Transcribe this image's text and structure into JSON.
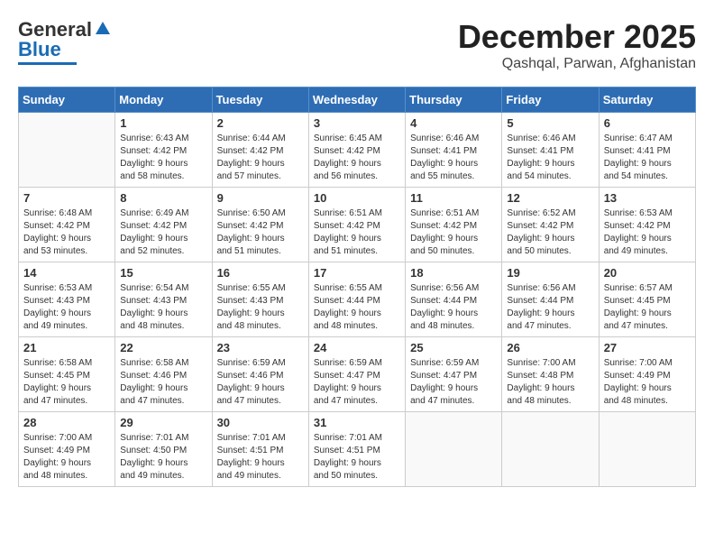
{
  "header": {
    "logo_general": "General",
    "logo_blue": "Blue",
    "month": "December 2025",
    "location": "Qashqal, Parwan, Afghanistan"
  },
  "days_of_week": [
    "Sunday",
    "Monday",
    "Tuesday",
    "Wednesday",
    "Thursday",
    "Friday",
    "Saturday"
  ],
  "weeks": [
    [
      {
        "day": "",
        "info": ""
      },
      {
        "day": "1",
        "info": "Sunrise: 6:43 AM\nSunset: 4:42 PM\nDaylight: 9 hours\nand 58 minutes."
      },
      {
        "day": "2",
        "info": "Sunrise: 6:44 AM\nSunset: 4:42 PM\nDaylight: 9 hours\nand 57 minutes."
      },
      {
        "day": "3",
        "info": "Sunrise: 6:45 AM\nSunset: 4:42 PM\nDaylight: 9 hours\nand 56 minutes."
      },
      {
        "day": "4",
        "info": "Sunrise: 6:46 AM\nSunset: 4:41 PM\nDaylight: 9 hours\nand 55 minutes."
      },
      {
        "day": "5",
        "info": "Sunrise: 6:46 AM\nSunset: 4:41 PM\nDaylight: 9 hours\nand 54 minutes."
      },
      {
        "day": "6",
        "info": "Sunrise: 6:47 AM\nSunset: 4:41 PM\nDaylight: 9 hours\nand 54 minutes."
      }
    ],
    [
      {
        "day": "7",
        "info": "Sunrise: 6:48 AM\nSunset: 4:42 PM\nDaylight: 9 hours\nand 53 minutes."
      },
      {
        "day": "8",
        "info": "Sunrise: 6:49 AM\nSunset: 4:42 PM\nDaylight: 9 hours\nand 52 minutes."
      },
      {
        "day": "9",
        "info": "Sunrise: 6:50 AM\nSunset: 4:42 PM\nDaylight: 9 hours\nand 51 minutes."
      },
      {
        "day": "10",
        "info": "Sunrise: 6:51 AM\nSunset: 4:42 PM\nDaylight: 9 hours\nand 51 minutes."
      },
      {
        "day": "11",
        "info": "Sunrise: 6:51 AM\nSunset: 4:42 PM\nDaylight: 9 hours\nand 50 minutes."
      },
      {
        "day": "12",
        "info": "Sunrise: 6:52 AM\nSunset: 4:42 PM\nDaylight: 9 hours\nand 50 minutes."
      },
      {
        "day": "13",
        "info": "Sunrise: 6:53 AM\nSunset: 4:42 PM\nDaylight: 9 hours\nand 49 minutes."
      }
    ],
    [
      {
        "day": "14",
        "info": "Sunrise: 6:53 AM\nSunset: 4:43 PM\nDaylight: 9 hours\nand 49 minutes."
      },
      {
        "day": "15",
        "info": "Sunrise: 6:54 AM\nSunset: 4:43 PM\nDaylight: 9 hours\nand 48 minutes."
      },
      {
        "day": "16",
        "info": "Sunrise: 6:55 AM\nSunset: 4:43 PM\nDaylight: 9 hours\nand 48 minutes."
      },
      {
        "day": "17",
        "info": "Sunrise: 6:55 AM\nSunset: 4:44 PM\nDaylight: 9 hours\nand 48 minutes."
      },
      {
        "day": "18",
        "info": "Sunrise: 6:56 AM\nSunset: 4:44 PM\nDaylight: 9 hours\nand 48 minutes."
      },
      {
        "day": "19",
        "info": "Sunrise: 6:56 AM\nSunset: 4:44 PM\nDaylight: 9 hours\nand 47 minutes."
      },
      {
        "day": "20",
        "info": "Sunrise: 6:57 AM\nSunset: 4:45 PM\nDaylight: 9 hours\nand 47 minutes."
      }
    ],
    [
      {
        "day": "21",
        "info": "Sunrise: 6:58 AM\nSunset: 4:45 PM\nDaylight: 9 hours\nand 47 minutes."
      },
      {
        "day": "22",
        "info": "Sunrise: 6:58 AM\nSunset: 4:46 PM\nDaylight: 9 hours\nand 47 minutes."
      },
      {
        "day": "23",
        "info": "Sunrise: 6:59 AM\nSunset: 4:46 PM\nDaylight: 9 hours\nand 47 minutes."
      },
      {
        "day": "24",
        "info": "Sunrise: 6:59 AM\nSunset: 4:47 PM\nDaylight: 9 hours\nand 47 minutes."
      },
      {
        "day": "25",
        "info": "Sunrise: 6:59 AM\nSunset: 4:47 PM\nDaylight: 9 hours\nand 47 minutes."
      },
      {
        "day": "26",
        "info": "Sunrise: 7:00 AM\nSunset: 4:48 PM\nDaylight: 9 hours\nand 48 minutes."
      },
      {
        "day": "27",
        "info": "Sunrise: 7:00 AM\nSunset: 4:49 PM\nDaylight: 9 hours\nand 48 minutes."
      }
    ],
    [
      {
        "day": "28",
        "info": "Sunrise: 7:00 AM\nSunset: 4:49 PM\nDaylight: 9 hours\nand 48 minutes."
      },
      {
        "day": "29",
        "info": "Sunrise: 7:01 AM\nSunset: 4:50 PM\nDaylight: 9 hours\nand 49 minutes."
      },
      {
        "day": "30",
        "info": "Sunrise: 7:01 AM\nSunset: 4:51 PM\nDaylight: 9 hours\nand 49 minutes."
      },
      {
        "day": "31",
        "info": "Sunrise: 7:01 AM\nSunset: 4:51 PM\nDaylight: 9 hours\nand 50 minutes."
      },
      {
        "day": "",
        "info": ""
      },
      {
        "day": "",
        "info": ""
      },
      {
        "day": "",
        "info": ""
      }
    ]
  ]
}
